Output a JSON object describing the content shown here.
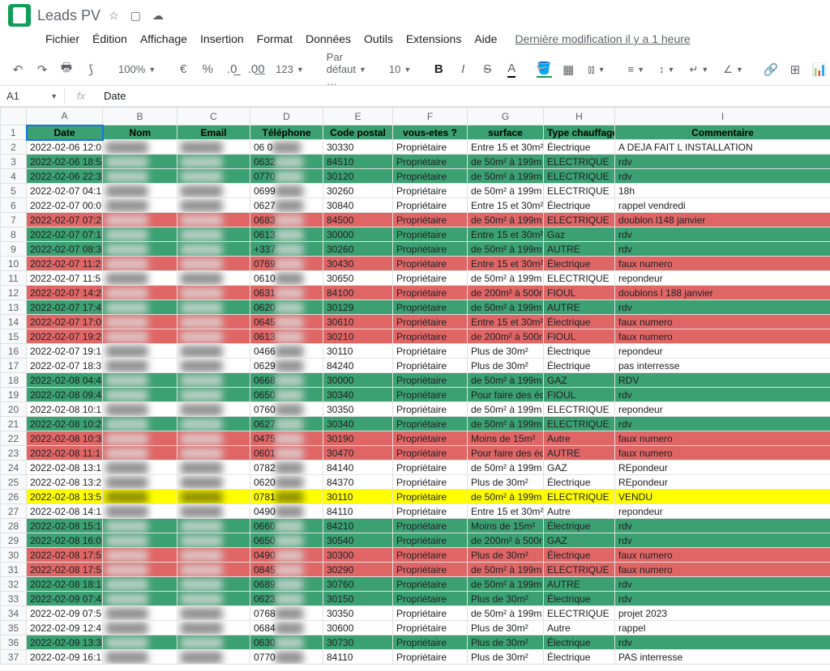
{
  "title": "Leads PV",
  "menubar": {
    "items": [
      "Fichier",
      "Édition",
      "Affichage",
      "Insertion",
      "Format",
      "Données",
      "Outils",
      "Extensions",
      "Aide"
    ],
    "lastmod": "Dernière modification il y a 1 heure"
  },
  "toolbar": {
    "zoom": "100%",
    "currency": "€",
    "pct": "%",
    "dec_dec": ".0̲",
    "dec_inc": ".0͟0",
    "fmt": "123",
    "font": "Par défaut …",
    "size": "10"
  },
  "namebox": "A1",
  "formula": "Date",
  "columns": [
    "A",
    "B",
    "C",
    "D",
    "E",
    "F",
    "G",
    "H",
    "I"
  ],
  "headers": [
    "Date",
    "Nom",
    "Email",
    "Téléphone",
    "Code postal",
    "vous-etes ?",
    "surface",
    "Type chauffage",
    "Commentaire"
  ],
  "rows": [
    {
      "n": 2,
      "c": "",
      "d": [
        "2022-02-06 12:0",
        "",
        "",
        "06 0",
        "30330",
        "Propriétaire",
        "Entre 15 et 30m²",
        "Électrique",
        "A DEJA FAIT L INSTALLATION"
      ]
    },
    {
      "n": 3,
      "c": "green",
      "d": [
        "2022-02-06 18:5",
        "",
        "",
        "0632",
        "84510",
        "Propriétaire",
        "de 50m² à 199m",
        "ELECTRIQUE",
        "rdv"
      ]
    },
    {
      "n": 4,
      "c": "green",
      "d": [
        "2022-02-06 22:3",
        "",
        "",
        "0770",
        "30120",
        "Propriétaire",
        "de 50m² à 199m",
        "ELECTRIQUE",
        "rdv"
      ]
    },
    {
      "n": 5,
      "c": "",
      "d": [
        "2022-02-07 04:1",
        "",
        "R",
        "0699",
        "30260",
        "Propriétaire",
        "de 50m² à 199m",
        "ELECTRIQUE",
        "18h"
      ]
    },
    {
      "n": 6,
      "c": "",
      "d": [
        "2022-02-07 00:0",
        "",
        "",
        "0627",
        "30840",
        "Propriétaire",
        "Entre 15 et 30m²",
        "Électrique",
        "rappel vendredi"
      ]
    },
    {
      "n": 7,
      "c": "red",
      "d": [
        "2022-02-07 07:2",
        "",
        "",
        "0683",
        "84500",
        "Propriétaire",
        "de 50m² à 199m",
        "ELECTRIQUE",
        "doublon l148 janvier"
      ]
    },
    {
      "n": 8,
      "c": "green",
      "d": [
        "2022-02-07 07:1",
        "",
        "",
        "0613",
        "30000",
        "Propriétaire",
        "Entre 15 et 30m²",
        "Gaz",
        "rdv"
      ]
    },
    {
      "n": 9,
      "c": "green",
      "d": [
        "2022-02-07 08:3",
        "",
        "N",
        "+337",
        "30260",
        "Propriétaire",
        "de 50m² à 199m",
        "AUTRE",
        "rdv"
      ]
    },
    {
      "n": 10,
      "c": "red",
      "d": [
        "2022-02-07 11:2",
        "",
        "",
        "0769",
        "30430",
        "Propriétaire",
        "Entre 15 et 30m²",
        "Électrique",
        "faux numero"
      ]
    },
    {
      "n": 11,
      "c": "",
      "d": [
        "2022-02-07 11:5",
        "",
        "",
        "0610",
        "30650",
        "Propriétaire",
        "de 50m² à 199m",
        "ELECTRIQUE",
        "repondeur"
      ]
    },
    {
      "n": 12,
      "c": "red",
      "d": [
        "2022-02-07 14:2",
        "",
        "",
        "0631",
        "84100",
        "Propriétaire",
        "de 200m² à 500r",
        "FIOUL",
        "doublons l 188 janvier"
      ]
    },
    {
      "n": 13,
      "c": "green",
      "d": [
        "2022-02-07 17:4",
        "",
        "",
        "0620",
        "30129",
        "Propriétaire",
        "de 50m² à 199m",
        "AUTRE",
        "rdv"
      ]
    },
    {
      "n": 14,
      "c": "red",
      "d": [
        "2022-02-07 17:0",
        "",
        "",
        "0645",
        "30610",
        "Propriétaire",
        "Entre 15 et 30m²",
        "Électrique",
        "faux numero"
      ]
    },
    {
      "n": 15,
      "c": "red",
      "d": [
        "2022-02-07 19:2",
        "",
        "",
        "0613",
        "30210",
        "Propriétaire",
        "de 200m² à 500r",
        "FIOUL",
        "faux numero"
      ]
    },
    {
      "n": 16,
      "c": "",
      "d": [
        "2022-02-07 19:1",
        "",
        "",
        "0466",
        "30110",
        "Propriétaire",
        "Plus de 30m²",
        "Électrique",
        "repondeur"
      ]
    },
    {
      "n": 17,
      "c": "",
      "d": [
        "2022-02-07 18:3",
        "",
        "",
        "0629",
        "84240",
        "Propriétaire",
        "Plus de 30m²",
        "Électrique",
        "pas interresse"
      ]
    },
    {
      "n": 18,
      "c": "green",
      "d": [
        "2022-02-08 04:4",
        "",
        "",
        "0668",
        "30000",
        "Propriétaire",
        "de 50m² à 199m",
        "GAZ",
        "RDV"
      ]
    },
    {
      "n": 19,
      "c": "green",
      "d": [
        "2022-02-08 09:4",
        "",
        "",
        "0650",
        "30340",
        "Propriétaire",
        "Pour faire des éc",
        "FIOUL",
        "rdv"
      ]
    },
    {
      "n": 20,
      "c": "",
      "d": [
        "2022-02-08 10:1",
        "",
        "",
        "0760",
        "30350",
        "Propriétaire",
        "de 50m² à 199m",
        "ELECTRIQUE",
        "repondeur"
      ]
    },
    {
      "n": 21,
      "c": "green",
      "d": [
        "2022-02-08 10:2",
        "",
        "",
        "0627",
        "30340",
        "Propriétaire",
        "de 50m² à 199m",
        "ELECTRIQUE",
        "rdv"
      ]
    },
    {
      "n": 22,
      "c": "red",
      "d": [
        "2022-02-08 10:3",
        "",
        "n",
        "0475",
        "30190",
        "Propriétaire",
        "Moins de 15m²",
        "Autre",
        "faux numero"
      ]
    },
    {
      "n": 23,
      "c": "red",
      "d": [
        "2022-02-08 11:1",
        "",
        "",
        "0601",
        "30470",
        "Propriétaire",
        "Pour faire des éc",
        "AUTRE",
        "faux numero"
      ]
    },
    {
      "n": 24,
      "c": "",
      "d": [
        "2022-02-08 13:1",
        "",
        "",
        "0782",
        "84140",
        "Propriétaire",
        "de 50m² à 199m",
        "GAZ",
        "REpondeur"
      ]
    },
    {
      "n": 25,
      "c": "",
      "d": [
        "2022-02-08 13:2",
        "",
        "",
        "0620",
        "84370",
        "Propriétaire",
        "Plus de 30m²",
        "Électrique",
        "REpondeur"
      ]
    },
    {
      "n": 26,
      "c": "yellow",
      "d": [
        "2022-02-08 13:5",
        "",
        "",
        "0781",
        "30110",
        "Propriétaire",
        "de 50m² à 199m",
        "ELECTRIQUE",
        "VENDU"
      ]
    },
    {
      "n": 27,
      "c": "",
      "d": [
        "2022-02-08 14:1",
        "",
        "",
        "0490",
        "84110",
        "Propriétaire",
        "Entre 15 et 30m²",
        "Autre",
        "repondeur"
      ]
    },
    {
      "n": 28,
      "c": "green",
      "d": [
        "2022-02-08 15:1",
        "",
        "",
        "0660",
        "84210",
        "Propriétaire",
        "Moins de 15m²",
        "Électrique",
        "rdv"
      ]
    },
    {
      "n": 29,
      "c": "green",
      "d": [
        "2022-02-08 16:0",
        "",
        "",
        "0650",
        "30540",
        "Propriétaire",
        "de 200m² à 500r",
        "GAZ",
        "rdv"
      ]
    },
    {
      "n": 30,
      "c": "red",
      "d": [
        "2022-02-08 17:5",
        "",
        "",
        "0490",
        "30300",
        "Propriétaire",
        "Plus de 30m²",
        "Électrique",
        "faux numero"
      ]
    },
    {
      "n": 31,
      "c": "red",
      "d": [
        "2022-02-08 17:5",
        "",
        "",
        "0845",
        "30290",
        "Propriétaire",
        "de 50m² à 199m",
        "ELECTRIQUE",
        "faux numero"
      ]
    },
    {
      "n": 32,
      "c": "green",
      "d": [
        "2022-02-08 18:1",
        "",
        "",
        "0689",
        "30760",
        "Propriétaire",
        "de 50m² à 199m",
        "AUTRE",
        "rdv"
      ]
    },
    {
      "n": 33,
      "c": "green",
      "d": [
        "2022-02-09 07:4",
        "",
        "",
        "0623",
        "30150",
        "Propriétaire",
        "Plus de 30m²",
        "Électrique",
        "rdv"
      ]
    },
    {
      "n": 34,
      "c": "",
      "d": [
        "2022-02-09 07:5",
        "",
        "",
        "0768",
        "30350",
        "Propriétaire",
        "de 50m² à 199m",
        "ELECTRIQUE",
        "projet 2023"
      ]
    },
    {
      "n": 35,
      "c": "",
      "d": [
        "2022-02-09 12:4",
        "",
        "",
        "0684",
        "30600",
        "Propriétaire",
        "Plus de 30m²",
        "Autre",
        "rappel"
      ]
    },
    {
      "n": 36,
      "c": "green",
      "d": [
        "2022-02-09 13:3",
        "",
        "",
        "0630",
        "30730",
        "Propriétaire",
        "Plus de 30m²",
        "Électrique",
        "rdv"
      ]
    },
    {
      "n": 37,
      "c": "",
      "d": [
        "2022-02-09 16:1",
        "",
        "",
        "0770",
        "84110",
        "Propriétaire",
        "Plus de 30m²",
        "Électrique",
        "PAS interresse"
      ]
    }
  ]
}
